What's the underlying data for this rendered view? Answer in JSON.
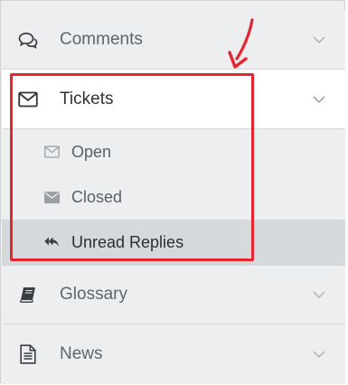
{
  "menu": {
    "comments": {
      "label": "Comments",
      "icon": "comments-icon"
    },
    "tickets": {
      "label": "Tickets",
      "icon": "envelope-icon",
      "items": [
        {
          "label": "Open",
          "icon": "envelope-open-icon"
        },
        {
          "label": "Closed",
          "icon": "envelope-closed-icon"
        },
        {
          "label": "Unread Replies",
          "icon": "reply-all-icon"
        }
      ]
    },
    "glossary": {
      "label": "Glossary",
      "icon": "book-icon"
    },
    "news": {
      "label": "News",
      "icon": "document-icon"
    }
  },
  "colors": {
    "annotation": "#e6262e",
    "active_header": "#ffffff",
    "selected_item": "#d6d9dc",
    "sidebar_bg": "#eceef0"
  }
}
